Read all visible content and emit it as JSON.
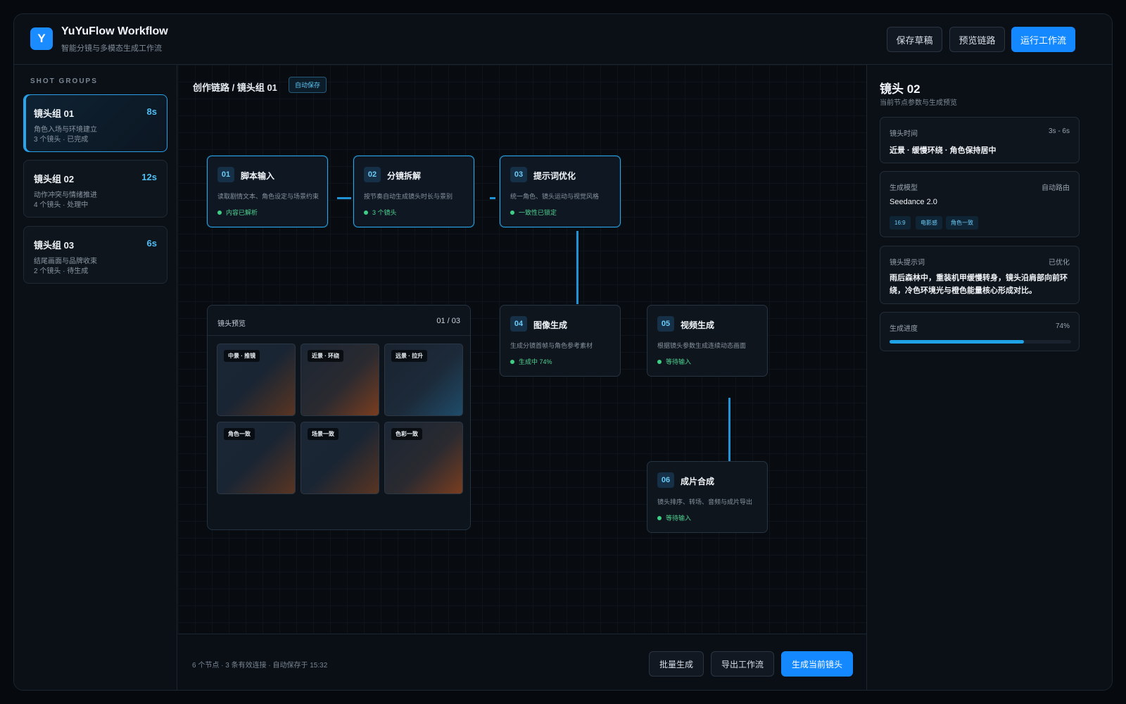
{
  "header": {
    "logo_letter": "Y",
    "title": "YuYuFlow Workflow",
    "subtitle": "智能分镜与多模态生成工作流",
    "buttons": {
      "save_draft": "保存草稿",
      "preview_chain": "预览链路",
      "run": "运行工作流"
    }
  },
  "sidebar": {
    "label": "SHOT GROUPS",
    "groups": [
      {
        "title": "镜头组 01",
        "duration": "8s",
        "desc": "角色入场与环境建立",
        "meta": "3 个镜头 · 已完成"
      },
      {
        "title": "镜头组 02",
        "duration": "12s",
        "desc": "动作冲突与情绪推进",
        "meta": "4 个镜头 · 处理中"
      },
      {
        "title": "镜头组 03",
        "duration": "6s",
        "desc": "结尾画面与品牌收束",
        "meta": "2 个镜头 · 待生成"
      }
    ]
  },
  "canvas": {
    "breadcrumb": "创作链路 / 镜头组 01",
    "autosave": "自动保存",
    "nodes": [
      {
        "num": "01",
        "title": "脚本输入",
        "desc": "读取剧情文本、角色设定与场景约束",
        "status": "内容已解析"
      },
      {
        "num": "02",
        "title": "分镜拆解",
        "desc": "按节奏自动生成镜头时长与景别",
        "status": "3 个镜头"
      },
      {
        "num": "03",
        "title": "提示词优化",
        "desc": "统一角色、镜头运动与视觉风格",
        "status": "一致性已锁定"
      },
      {
        "num": "04",
        "title": "图像生成",
        "desc": "生成分镜首帧与角色参考素材",
        "status": "生成中 74%"
      },
      {
        "num": "05",
        "title": "视频生成",
        "desc": "根据镜头参数生成连续动态画面",
        "status": "等待输入"
      },
      {
        "num": "06",
        "title": "成片合成",
        "desc": "镜头排序、转场、音频与成片导出",
        "status": "等待输入"
      }
    ],
    "preview": {
      "title": "镜头预览",
      "page": "01 / 03",
      "thumbs": [
        "中景 · 推镜",
        "近景 · 环绕",
        "远景 · 拉升",
        "角色一致",
        "场景一致",
        "色彩一致"
      ]
    }
  },
  "footer": {
    "info": "6 个节点 · 3 条有效连接 · 自动保存于 15:32",
    "buttons": {
      "batch": "批量生成",
      "export": "导出工作流",
      "generate": "生成当前镜头"
    }
  },
  "inspector": {
    "title": "镜头 02",
    "subtitle": "当前节点参数与生成预览",
    "time": {
      "label": "镜头时间",
      "range": "3s - 6s",
      "value": "近景 · 缓慢环绕 · 角色保持居中"
    },
    "model": {
      "label": "生成模型",
      "route": "自动路由",
      "value": "Seedance 2.0",
      "chips": [
        "16:9",
        "电影感",
        "角色一致"
      ]
    },
    "prompt": {
      "label": "镜头提示词",
      "state": "已优化",
      "text": "雨后森林中，重装机甲缓慢转身，镜头沿肩部向前环绕，冷色环境光与橙色能量核心形成对比。"
    },
    "progress": {
      "label": "生成进度",
      "value": "74%",
      "fraction": 0.74
    }
  }
}
